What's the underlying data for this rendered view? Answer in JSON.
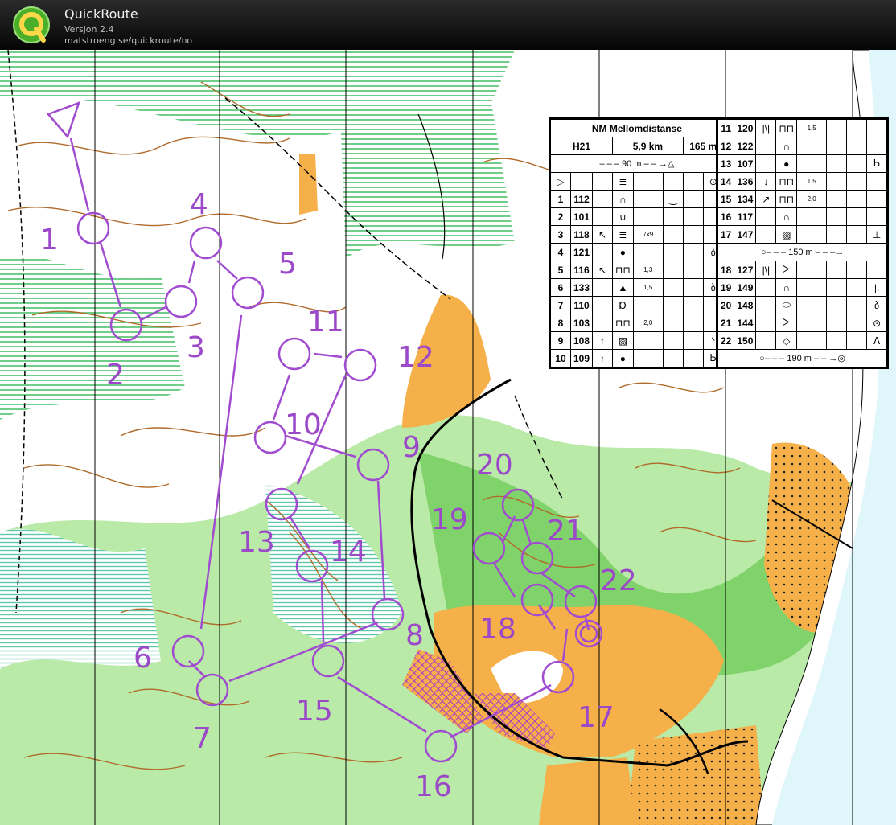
{
  "app": {
    "title": "QuickRoute",
    "version": "Versjon 2.4",
    "url": "matstroeng.se/quickroute/no"
  },
  "controls": [
    {
      "label": "1"
    },
    {
      "label": "2"
    },
    {
      "label": "3"
    },
    {
      "label": "4"
    },
    {
      "label": "5"
    },
    {
      "label": "6"
    },
    {
      "label": "7"
    },
    {
      "label": "8"
    },
    {
      "label": "9"
    },
    {
      "label": "10"
    },
    {
      "label": "11"
    },
    {
      "label": "12"
    },
    {
      "label": "13"
    },
    {
      "label": "14"
    },
    {
      "label": "15"
    },
    {
      "label": "16"
    },
    {
      "label": "17"
    },
    {
      "label": "18"
    },
    {
      "label": "19"
    },
    {
      "label": "20"
    },
    {
      "label": "21"
    },
    {
      "label": "22"
    }
  ],
  "description": {
    "event": "NM Mellomdistanse",
    "class": "H21",
    "length": "5,9 km",
    "climb": "165 m",
    "start_leg": "90 m",
    "leg_mid": "150 m",
    "leg_finish": "190 m",
    "rows_left": [
      {
        "n": "1",
        "code": "112",
        "dir": "",
        "feat": "∩",
        "dim": "",
        "extra": "‿",
        "last": ""
      },
      {
        "n": "2",
        "code": "101",
        "dir": "",
        "feat": "∪",
        "dim": "",
        "extra": "",
        "last": ""
      },
      {
        "n": "3",
        "code": "118",
        "dir": "↖",
        "feat": "≣",
        "dim": "7x9",
        "extra": "",
        "last": ""
      },
      {
        "n": "4",
        "code": "121",
        "dir": "",
        "feat": "●",
        "dim": "",
        "extra": "",
        "last": "ბ"
      },
      {
        "n": "5",
        "code": "116",
        "dir": "↖",
        "feat": "⊓⊓",
        "dim": "1,3",
        "extra": "",
        "last": ""
      },
      {
        "n": "6",
        "code": "133",
        "dir": "",
        "feat": "▲",
        "dim": "1,5",
        "extra": "",
        "last": "ბ"
      },
      {
        "n": "7",
        "code": "110",
        "dir": "",
        "feat": "Ɒ",
        "dim": "",
        "extra": "",
        "last": ""
      },
      {
        "n": "8",
        "code": "103",
        "dir": "",
        "feat": "⊓⊓",
        "dim": "2,0",
        "extra": "",
        "last": ""
      },
      {
        "n": "9",
        "code": "108",
        "dir": "↑",
        "feat": "▨",
        "dim": "",
        "extra": "",
        "last": "ᐠ"
      },
      {
        "n": "10",
        "code": "109",
        "dir": "↑",
        "feat": "●",
        "dim": "",
        "extra": "",
        "last": "Ꮟ"
      }
    ],
    "rows_right_a": [
      {
        "n": "11",
        "code": "120",
        "dir": "|\\|",
        "feat": "⊓⊓",
        "dim": "1,5",
        "extra": "",
        "last": ""
      },
      {
        "n": "12",
        "code": "122",
        "dir": "",
        "feat": "∩",
        "dim": "",
        "extra": "",
        "last": ""
      },
      {
        "n": "13",
        "code": "107",
        "dir": "",
        "feat": "●",
        "dim": "",
        "extra": "",
        "last": "Ꮟ"
      },
      {
        "n": "14",
        "code": "136",
        "dir": "↓",
        "feat": "⊓⊓",
        "dim": "1,5",
        "extra": "",
        "last": ""
      },
      {
        "n": "15",
        "code": "134",
        "dir": "↗",
        "feat": "⊓⊓",
        "dim": "2,0",
        "extra": "",
        "last": ""
      },
      {
        "n": "16",
        "code": "117",
        "dir": "",
        "feat": "∩",
        "dim": "",
        "extra": "",
        "last": ""
      },
      {
        "n": "17",
        "code": "147",
        "dir": "",
        "feat": "▨",
        "dim": "",
        "extra": "",
        "last": "⊥"
      }
    ],
    "rows_right_b": [
      {
        "n": "18",
        "code": "127",
        "dir": "|\\|",
        "feat": "ᗒ",
        "dim": "",
        "extra": "",
        "last": ""
      },
      {
        "n": "19",
        "code": "149",
        "dir": "",
        "feat": "∩",
        "dim": "",
        "extra": "",
        "last": "|."
      },
      {
        "n": "20",
        "code": "148",
        "dir": "",
        "feat": "⬭",
        "dim": "",
        "extra": "",
        "last": "ბ"
      },
      {
        "n": "21",
        "code": "144",
        "dir": "",
        "feat": "ᗒ",
        "dim": "",
        "extra": "",
        "last": "⊙"
      },
      {
        "n": "22",
        "code": "150",
        "dir": "",
        "feat": "◇",
        "dim": "",
        "extra": "",
        "last": "ᐱ"
      }
    ]
  },
  "colors": {
    "course": "#a04bd0",
    "forest_white": "#ffffff",
    "green": "#8ddc7a",
    "green_light": "#c6efb8",
    "open": "#f7b54b",
    "contour": "#b06a2a",
    "water": "#48c8d8"
  }
}
